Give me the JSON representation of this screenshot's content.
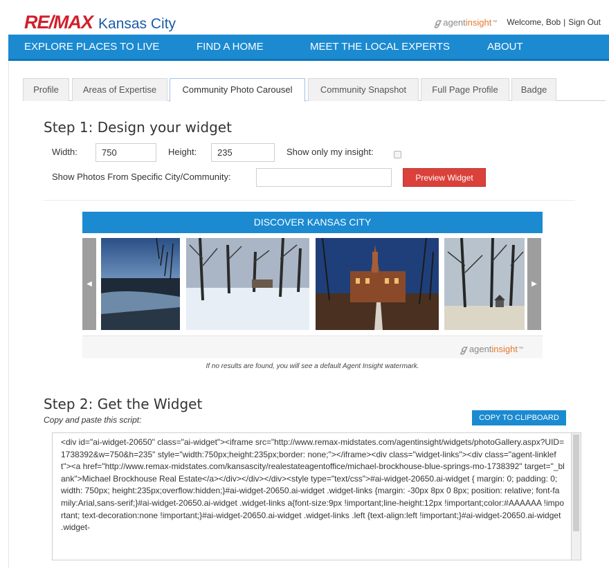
{
  "header": {
    "brand_re": "RE/",
    "brand_max": "MAX",
    "city": "Kansas City",
    "ai_logo_agent": "agent",
    "ai_logo_insight": "insight",
    "ai_logo_tm": "™",
    "welcome": "Welcome, Bob",
    "separator": "|",
    "sign_out": "Sign Out"
  },
  "nav": [
    {
      "label": "EXPLORE PLACES TO LIVE"
    },
    {
      "label": "FIND A HOME"
    },
    {
      "label": "MEET THE LOCAL EXPERTS"
    },
    {
      "label": "ABOUT"
    }
  ],
  "tabs": [
    {
      "label": "Profile"
    },
    {
      "label": "Areas of Expertise"
    },
    {
      "label": "Community Photo Carousel",
      "active": true
    },
    {
      "label": "Community Snapshot"
    },
    {
      "label": "Full Page Profile"
    },
    {
      "label": "Badge"
    }
  ],
  "step1": {
    "title": "Step 1: Design your widget",
    "width_label": "Width:",
    "width_value": "750",
    "height_label": "Height:",
    "height_value": "235",
    "insight_label": "Show only my insight:",
    "city_label": "Show Photos From Specific City/Community:",
    "city_value": "",
    "preview_button": "Preview Widget"
  },
  "widget": {
    "title": "DISCOVER KANSAS CITY",
    "prev_icon": "◀",
    "next_icon": "▶",
    "photos": [
      "sunset-river-photo",
      "snowy-park-photo",
      "university-building-photo",
      "winter-gazebo-photo"
    ],
    "note": "If no results are found, you will see a default Agent Insight watermark."
  },
  "step2": {
    "title": "Step 2: Get the Widget",
    "subtitle": "Copy and paste this script:",
    "copy_button": "COPY TO CLIPBOARD",
    "script": "<div id=\"ai-widget-20650\" class=\"ai-widget\"><iframe src=\"http://www.remax-midstates.com/agentinsight/widgets/photoGallery.aspx?UID=1738392&w=750&h=235\" style=\"width:750px;height:235px;border: none;\"></iframe><div class=\"widget-links\"><div class=\"agent-linkleft\"><a href=\"http://www.remax-midstates.com/kansascity/realestateagentoffice/michael-brockhouse-blue-springs-mo-1738392\" target=\"_blank\">Michael Brockhouse Real Estate</a></div></div></div><style type=\"text/css\">#ai-widget-20650.ai-widget { margin: 0; padding: 0; width: 750px; height:235px;overflow:hidden;}#ai-widget-20650.ai-widget .widget-links {margin: -30px 8px 0 8px; position: relative; font-family:Arial,sans-serif;}#ai-widget-20650.ai-widget .widget-links a{font-size:9px !important;line-height:12px !important;color:#AAAAAA !important; text-decoration:none !important;}#ai-widget-20650.ai-widget .widget-links .left {text-align:left !important;}#ai-widget-20650.ai-widget .widget-"
  },
  "colors": {
    "brand_red": "#d21f2b",
    "brand_blue": "#1a5aa8",
    "nav_blue": "#1b8ad1",
    "button_red": "#d9413a",
    "insight_orange": "#e5772b"
  }
}
